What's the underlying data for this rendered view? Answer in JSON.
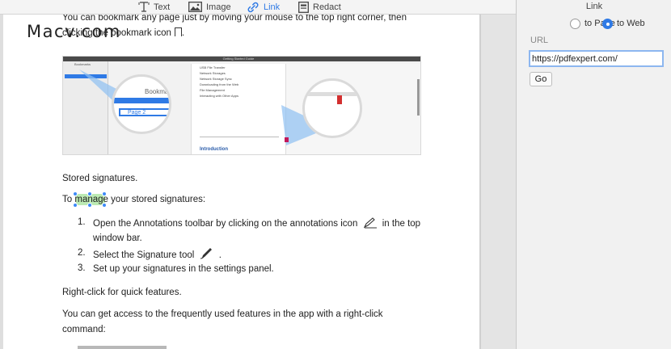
{
  "toolbar": {
    "text_label": "Text",
    "image_label": "Image",
    "link_label": "Link",
    "redact_label": "Redact"
  },
  "watermark": "Macv.com",
  "document": {
    "line_top": "You can bookmark any page just by moving your mouse to the top right corner, then",
    "line_2": "clicking the bookmark icon",
    "line_2_end": ".",
    "embedded": {
      "sidebar_title": "Bookmarks",
      "doc_title": "Getting Started Guide",
      "toc": [
        "USB File Transfer",
        "Network Storages",
        "Network Storage Sync",
        "Downloading from the Web",
        "File Management",
        "Interacting with Other Apps"
      ],
      "intro_heading": "Introduction",
      "lens_label": "Bookmark",
      "lens_page": "Page 2"
    },
    "heading_sig": "Stored signatures.",
    "manage_prefix": "To",
    "manage_selected": "manage",
    "manage_suffix": "your stored signatures:",
    "steps": [
      {
        "num": "1.",
        "text": "Open the Annotations toolbar by clicking on the annotations icon",
        "text_end": "in the top",
        "cont": "window bar."
      },
      {
        "num": "2.",
        "text": "Select the Signature tool",
        "text_end": "."
      },
      {
        "num": "3.",
        "text": "Set up your signatures in the settings panel."
      }
    ],
    "heading_right": "Right-click for quick features.",
    "para_1": "You can get access to the frequently used features in the app with a right-click",
    "para_2": "command:"
  },
  "panel": {
    "title": "Link",
    "option_page": "to Page",
    "option_web": "to Web",
    "selected_option": "to Web",
    "url_label": "URL",
    "url_value": "https://pdfexpert.com/",
    "go_label": "Go"
  },
  "colors": {
    "accent": "#2f7ae5",
    "selection": "#a6e39a"
  }
}
